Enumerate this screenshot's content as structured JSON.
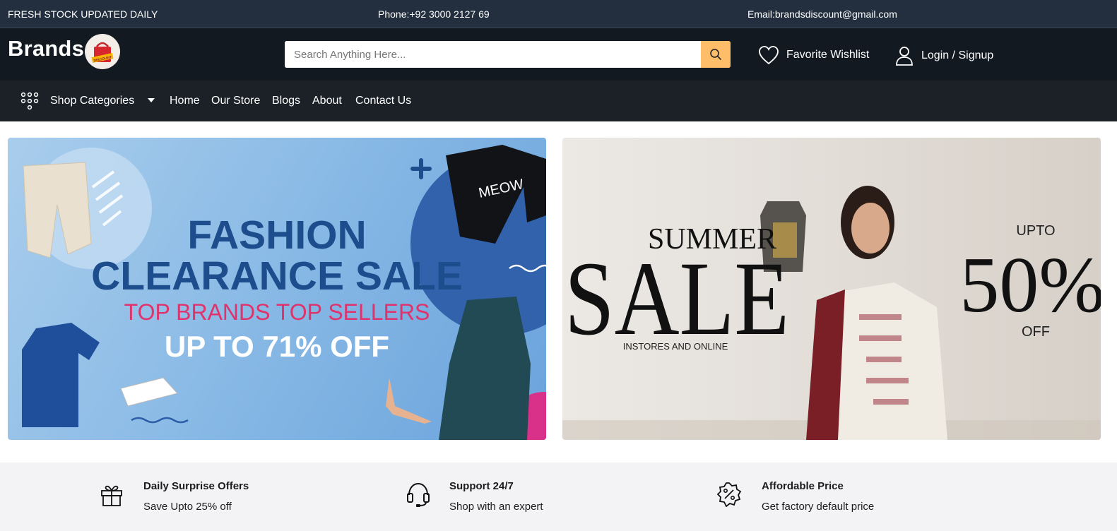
{
  "topbar": {
    "stock_text": "FRESH STOCK UPDATED DAILY",
    "phone": "Phone:+92 3000 2127 69",
    "email": "Email:brandsdiscount@gmail.com"
  },
  "header": {
    "logo_text": "Brands",
    "logo_badge_text": "DISCOUNT",
    "search_placeholder": "Search Anything Here...",
    "wishlist_label": "Favorite Wishlist",
    "login_label": "Login / Signup"
  },
  "nav": {
    "categories_label": "Shop Categories",
    "items": [
      "Home",
      "Our Store",
      "Blogs",
      "About",
      "Contact Us"
    ]
  },
  "banner_left": {
    "line1": "FASHION",
    "line2": "CLEARANCE SALE",
    "line3": "TOP BRANDS TOP SELLERS",
    "line4": "UP TO 71% OFF",
    "shirt_text": "MEOW"
  },
  "banner_right": {
    "summer": "SUMMER",
    "sale": "SALE",
    "instores": "INSTORES AND ONLINE",
    "upto": "UPTO",
    "percent": "50%",
    "off": "OFF"
  },
  "features": [
    {
      "title": "Daily Surprise Offers",
      "subtitle": "Save Upto 25% off",
      "icon": "gift-icon"
    },
    {
      "title": "Support 24/7",
      "subtitle": "Shop with an expert",
      "icon": "headset-icon"
    },
    {
      "title": "Affordable Price",
      "subtitle": "Get factory default price",
      "icon": "discount-badge-icon"
    }
  ],
  "colors": {
    "topbar_bg": "#232f3e",
    "header_bg": "#131921",
    "nav_bg": "#1c2128",
    "search_button": "#febd69",
    "banner_navy": "#1d4d8c",
    "banner_pink": "#e0336b"
  }
}
